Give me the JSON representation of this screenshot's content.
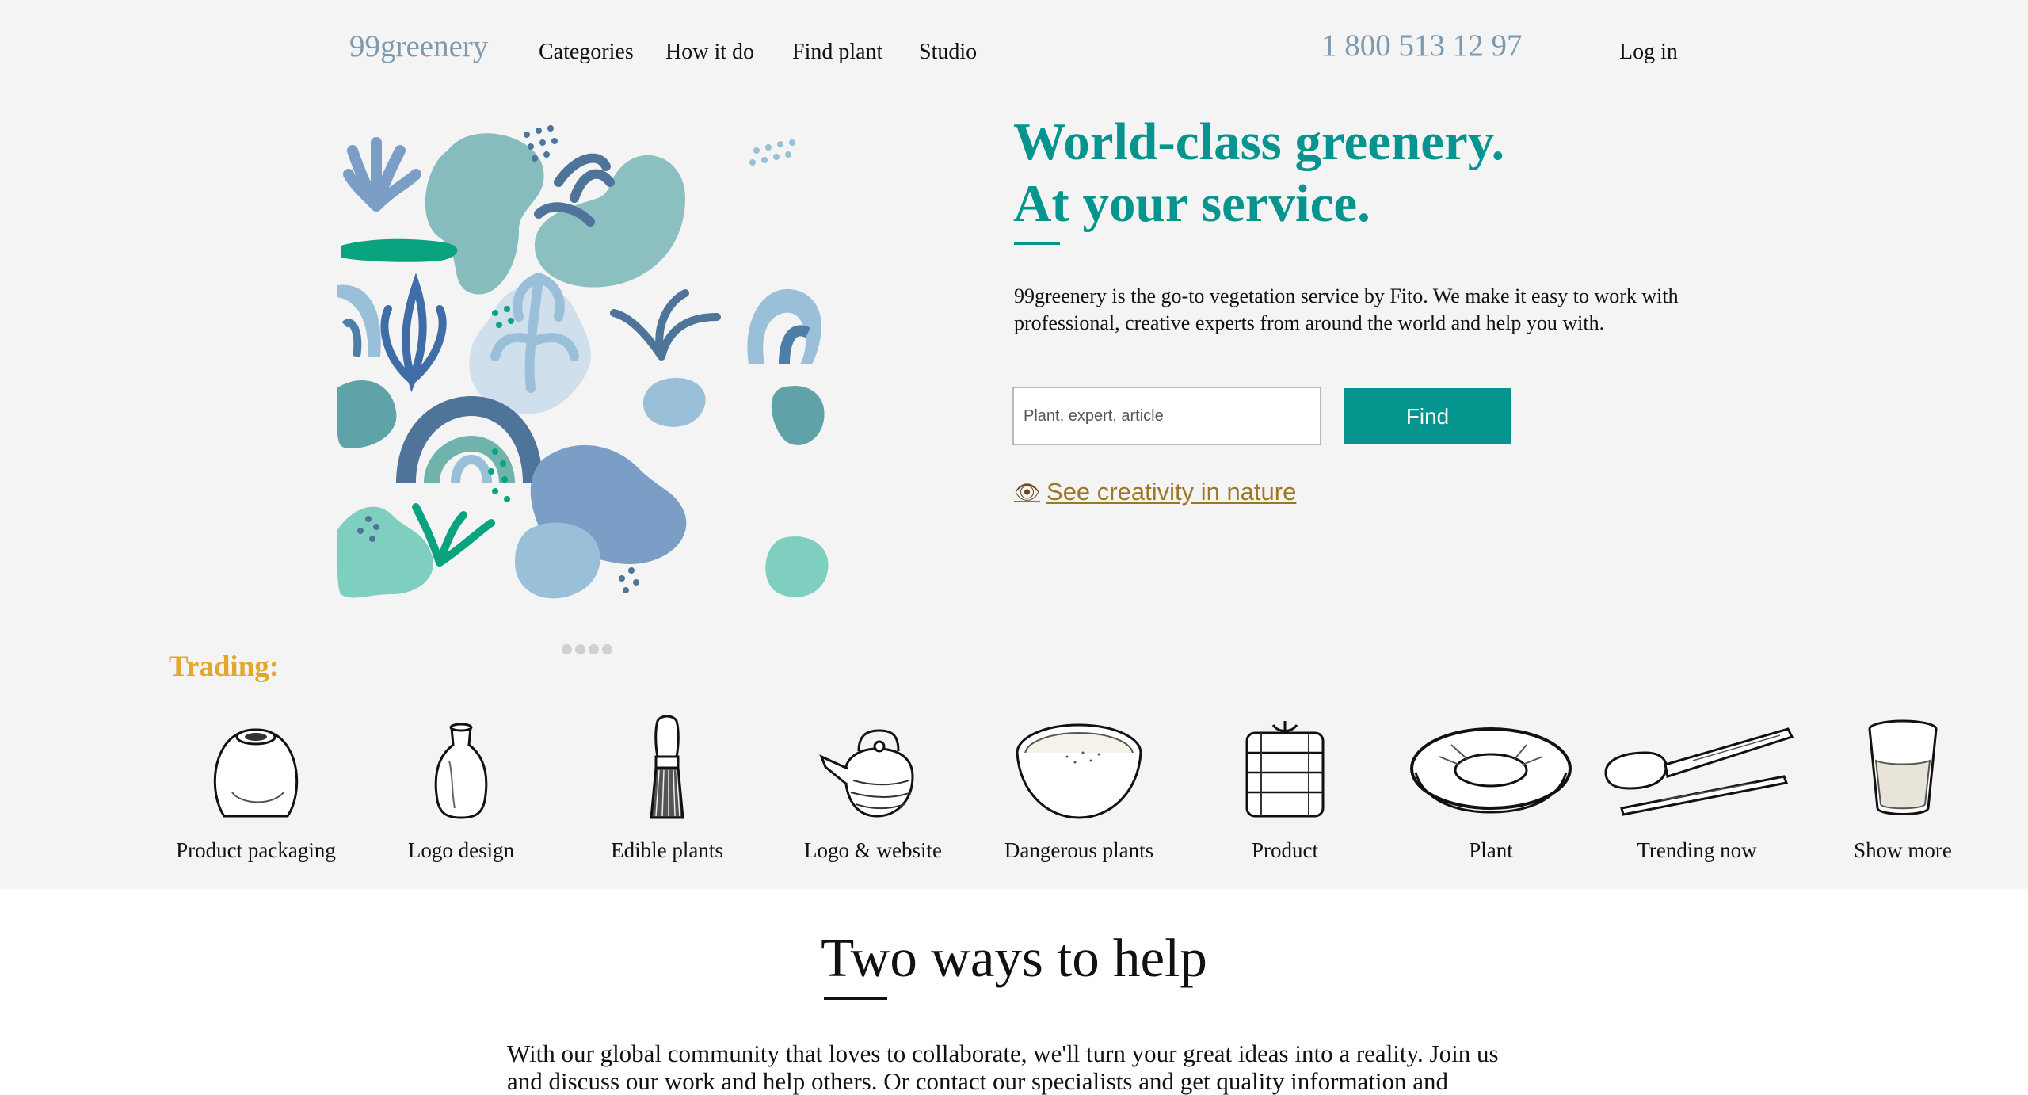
{
  "header": {
    "logo": "99greenery",
    "nav": [
      "Categories",
      "How it do",
      "Find plant",
      "Studio"
    ],
    "phone": "1 800 513 12 97",
    "login": "Log in"
  },
  "hero": {
    "title_line1": "World-class greenery.",
    "title_line2": "At your service.",
    "text": "99greenery is the go-to vegetation service by Fito. We make it easy to work with professional, creative experts from around the world and help you with.",
    "search_placeholder": "Plant, expert, article",
    "find_label": "Find",
    "creative_link": "See creativity in nature",
    "carousel_dots": 4
  },
  "trading": {
    "title": "Trading:",
    "items": [
      {
        "label": "Product packaging",
        "icon": "round-vase-icon"
      },
      {
        "label": "Logo design",
        "icon": "bottle-vase-icon"
      },
      {
        "label": "Edible plants",
        "icon": "whisk-icon"
      },
      {
        "label": "Logo & website",
        "icon": "teapot-icon"
      },
      {
        "label": "Dangerous plants",
        "icon": "bowl-icon"
      },
      {
        "label": "Product",
        "icon": "tea-bundle-icon"
      },
      {
        "label": "Plant",
        "icon": "plate-icon"
      },
      {
        "label": "Trending now",
        "icon": "spoon-icon"
      },
      {
        "label": "Show more",
        "icon": "glass-cup-icon"
      }
    ]
  },
  "section2": {
    "title": "Two ways to help",
    "text": "With our global community that loves to collaborate, we'll turn your great ideas into a reality. Join us and discuss our work and help others. Or contact our specialists and get quality information and"
  },
  "colors": {
    "brand": "#05948e",
    "logo": "#7d9bb0",
    "trading": "#e3a72c",
    "link": "#9a7826"
  }
}
